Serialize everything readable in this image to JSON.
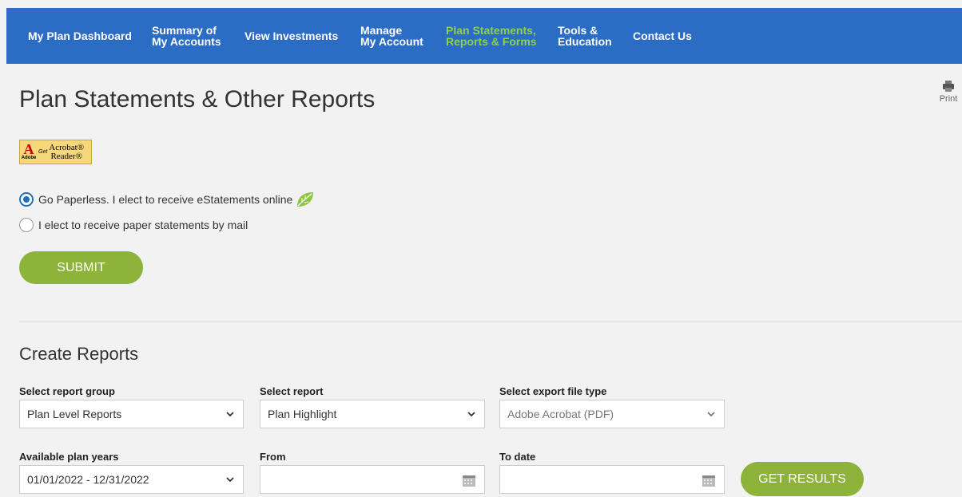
{
  "nav": {
    "items": [
      {
        "line1": "My Plan Dashboard",
        "line2": ""
      },
      {
        "line1": "Summary of",
        "line2": "My Accounts"
      },
      {
        "line1": "View Investments",
        "line2": ""
      },
      {
        "line1": "Manage",
        "line2": "My Account"
      },
      {
        "line1": "Plan Statements,",
        "line2": "Reports & Forms"
      },
      {
        "line1": "Tools &",
        "line2": "Education"
      },
      {
        "line1": "Contact Us",
        "line2": ""
      }
    ],
    "active_index": 4,
    "bg_color": "#2b6cc4",
    "active_color": "#8fd14f"
  },
  "page": {
    "title": "Plan Statements & Other Reports",
    "print_label": "Print"
  },
  "acrobat_badge": {
    "brand": "Adobe",
    "get": "Get",
    "product_line1": "Acrobat®",
    "product_line2": "Reader®"
  },
  "delivery": {
    "paperless_label": "Go Paperless. I elect to receive eStatements online",
    "paper_label": "I elect to receive paper statements by mail",
    "selected": "paperless",
    "submit_label": "SUBMIT"
  },
  "reports": {
    "section_title": "Create Reports",
    "group_label": "Select report group",
    "group_value": "Plan Level Reports",
    "report_label": "Select report",
    "report_value": "Plan Highlight",
    "export_label": "Select export file type",
    "export_value": "Adobe Acrobat (PDF)",
    "years_label": "Available plan years",
    "years_value": "01/01/2022 - 12/31/2022",
    "from_label": "From",
    "from_value": "",
    "to_label": "To date",
    "to_value": "",
    "get_results_label": "GET RESULTS"
  },
  "colors": {
    "button_green": "#8db33a",
    "radio_blue": "#1f6fb8",
    "leaf_green": "#8cc63f"
  }
}
